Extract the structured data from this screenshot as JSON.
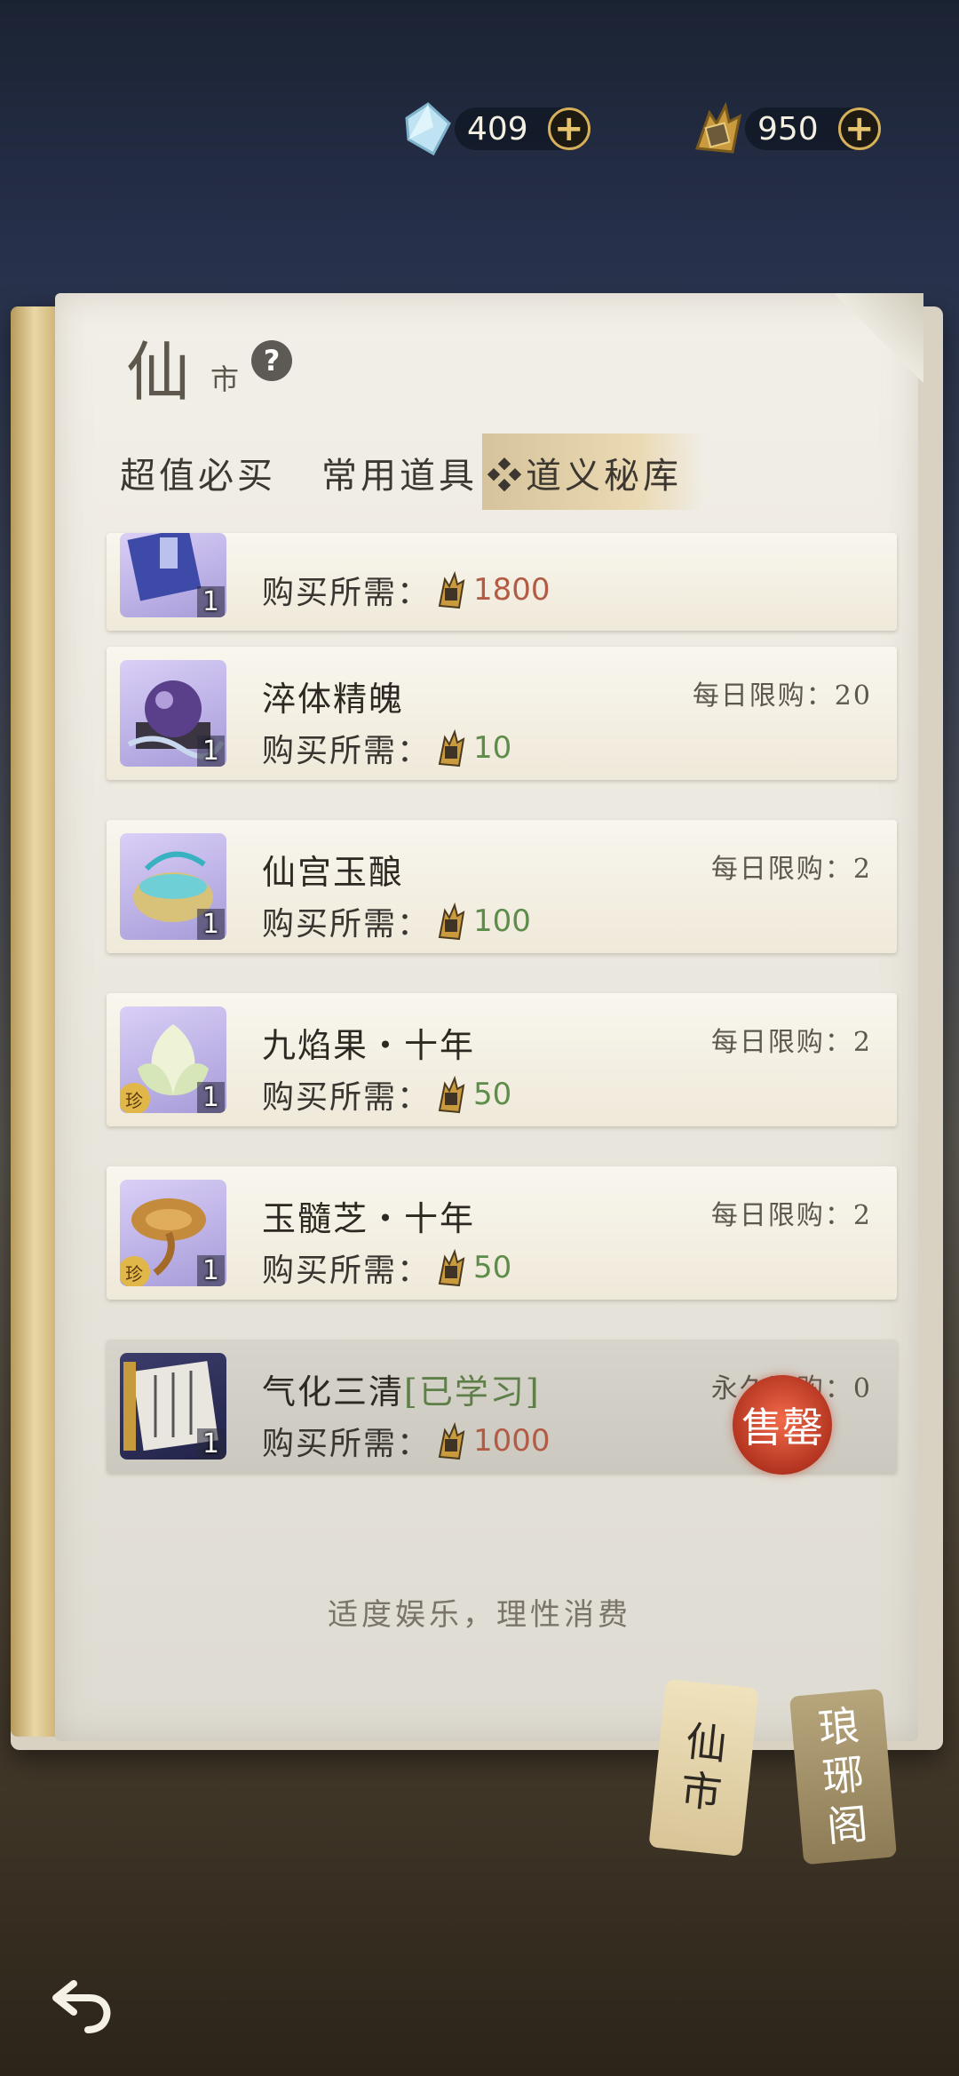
{
  "currency": {
    "jade_amount": "409",
    "token_amount": "950",
    "jade_icon": "jade-crystal-icon",
    "token_icon": "dao-token-icon",
    "plus_label": "+"
  },
  "header": {
    "title_main": "仙",
    "title_sub": "市",
    "help_label": "?"
  },
  "tabs": [
    {
      "label": "超值必买"
    },
    {
      "label": "常用道具"
    },
    {
      "label": "❖道义秘库",
      "active": true
    }
  ],
  "items": [
    {
      "name": "",
      "price_label": "购买所需：",
      "price": "1800",
      "price_color": "#b25c45",
      "qty": "1",
      "limit": ""
    },
    {
      "name": "淬体精魄",
      "price_label": "购买所需：",
      "price": "10",
      "price_color": "#5e8c4a",
      "qty": "1",
      "limit": "每日限购：20"
    },
    {
      "name": "仙宫玉酿",
      "price_label": "购买所需：",
      "price": "100",
      "price_color": "#5e8c4a",
      "qty": "1",
      "limit": "每日限购：2"
    },
    {
      "name": "九焰果・十年",
      "price_label": "购买所需：",
      "price": "50",
      "price_color": "#5e8c4a",
      "qty": "1",
      "limit": "每日限购：2",
      "rare": "珍"
    },
    {
      "name": "玉髓芝・十年",
      "price_label": "购买所需：",
      "price": "50",
      "price_color": "#5e8c4a",
      "qty": "1",
      "limit": "每日限购：2",
      "rare": "珍"
    },
    {
      "name": "气化三清",
      "name_suffix": "[已学习]",
      "price_label": "购买所需：",
      "price": "1000",
      "price_color": "#b25c45",
      "qty": "1",
      "limit": "永久限购：0",
      "sold_label": "售罄"
    }
  ],
  "notice": "适度娱乐，理性消费",
  "bookmarks": [
    {
      "label_1": "仙",
      "label_2": "市"
    },
    {
      "label_1": "琅",
      "label_2": "琊",
      "label_3": "阁"
    }
  ],
  "back_icon": "back-arrow-icon"
}
